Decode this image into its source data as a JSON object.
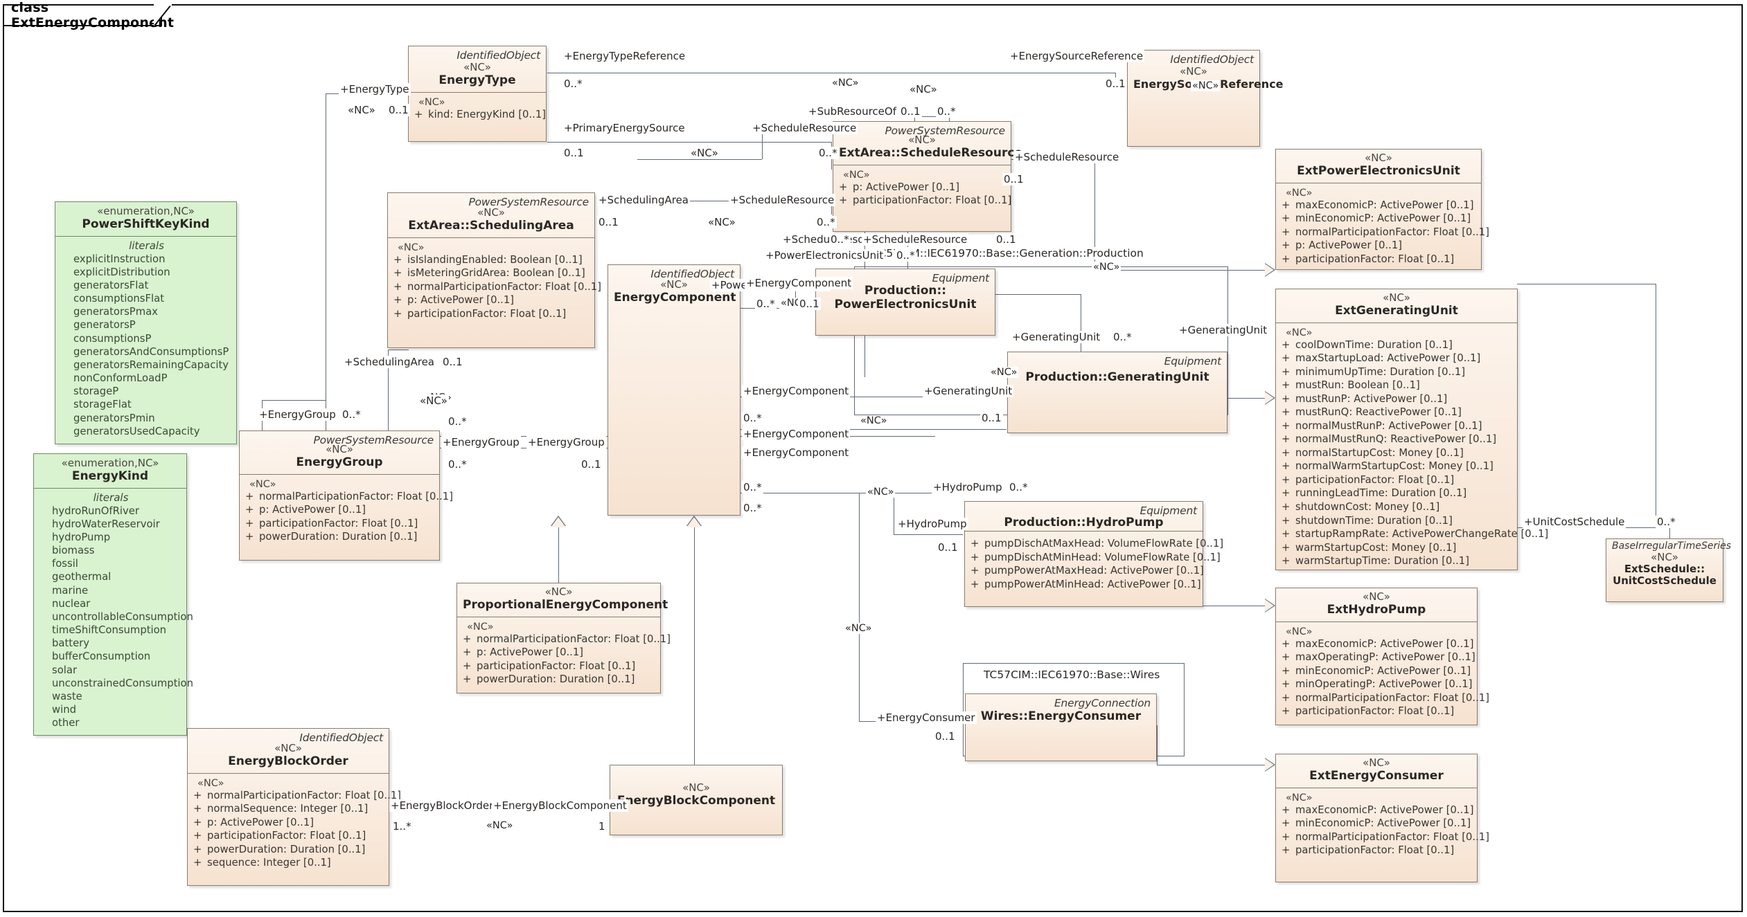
{
  "diagram": {
    "frame_label": "class ExtEnergyComponent"
  },
  "stereotype_nc": "«NC»",
  "literals_label": "literals",
  "enumerations": [
    {
      "id": "powershiftkeykind",
      "stereotype": "«enumeration,NC»",
      "name": "PowerShiftKeyKind",
      "literals": [
        "explicitInstruction",
        "explicitDistribution",
        "generatorsFlat",
        "consumptionsFlat",
        "generatorsPmax",
        "generatorsP",
        "consumptionsP",
        "generatorsAndConsumptionsP",
        "generatorsRemainingCapacity",
        "nonConformLoadP",
        "storageP",
        "storageFlat",
        "generatorsPmin",
        "generatorsUsedCapacity"
      ]
    },
    {
      "id": "energykind",
      "stereotype": "«enumeration,NC»",
      "name": "EnergyKind",
      "literals": [
        "hydroRunOfRiver",
        "hydroWaterReservoir",
        "hydroPump",
        "biomass",
        "fossil",
        "geothermal",
        "marine",
        "nuclear",
        "uncontrollableConsumption",
        "timeShiftConsumption",
        "battery",
        "bufferConsumption",
        "solar",
        "unconstrainedConsumption",
        "waste",
        "wind",
        "other"
      ]
    }
  ],
  "classes": [
    {
      "id": "energytype",
      "parent": "IdentifiedObject",
      "stereotype": "«NC»",
      "name": "EnergyType",
      "attrs": [
        "kind: EnergyKind [0..1]"
      ]
    },
    {
      "id": "energysourcereference",
      "parent": "IdentifiedObject",
      "stereotype": "«NC»",
      "name": "EnergySourceReference",
      "attrs": []
    },
    {
      "id": "schedulingarea",
      "parent": "PowerSystemResource",
      "stereotype": "«NC»",
      "name": "ExtArea::SchedulingArea",
      "attrs": [
        "isIslandingEnabled: Boolean [0..1]",
        "isMeteringGridArea: Boolean [0..1]",
        "normalParticipationFactor: Float [0..1]",
        "p: ActivePower [0..1]",
        "participationFactor: Float [0..1]"
      ]
    },
    {
      "id": "scheduleresource",
      "parent": "PowerSystemResource",
      "stereotype": "«NC»",
      "name": "ExtArea::ScheduleResource",
      "attrs": [
        "p: ActivePower [0..1]",
        "participationFactor: Float [0..1]"
      ]
    },
    {
      "id": "energycomponent",
      "parent": "IdentifiedObject",
      "stereotype": "«NC»",
      "name": "EnergyComponent",
      "attrs": []
    },
    {
      "id": "energygroup",
      "parent": "PowerSystemResource",
      "stereotype": "«NC»",
      "name": "EnergyGroup",
      "attrs": [
        "normalParticipationFactor: Float [0..1]",
        "p: ActivePower [0..1]",
        "participationFactor: Float [0..1]",
        "powerDuration: Duration [0..1]"
      ]
    },
    {
      "id": "proportionalenergycomponent",
      "parent": "",
      "stereotype": "«NC»",
      "name": "ProportionalEnergyComponent",
      "attrs": [
        "normalParticipationFactor: Float [0..1]",
        "p: ActivePower [0..1]",
        "participationFactor: Float [0..1]",
        "powerDuration: Duration [0..1]"
      ]
    },
    {
      "id": "energyblockorder",
      "parent": "IdentifiedObject",
      "stereotype": "«NC»",
      "name": "EnergyBlockOrder",
      "attrs": [
        "normalParticipationFactor: Float [0..1]",
        "normalSequence: Integer [0..1]",
        "p: ActivePower [0..1]",
        "participationFactor: Float [0..1]",
        "powerDuration: Duration [0..1]",
        "sequence: Integer [0..1]"
      ]
    },
    {
      "id": "energyblockcomponent",
      "parent": "",
      "stereotype": "«NC»",
      "name": "EnergyBlockComponent",
      "attrs": []
    },
    {
      "id": "prodpowerelectronicsunit",
      "parent": "Equipment",
      "stereotype": "",
      "name": "Production::\nPowerElectronicsUnit",
      "name_line1": "Production::",
      "name_line2": "PowerElectronicsUnit",
      "attrs": []
    },
    {
      "id": "prodgeneratingunit",
      "parent": "Equipment",
      "stereotype": "",
      "name": "Production::GeneratingUnit",
      "attrs": []
    },
    {
      "id": "prodhydropump",
      "parent": "Equipment",
      "stereotype": "",
      "name": "Production::HydroPump",
      "attrs": [
        "pumpDischAtMaxHead: VolumeFlowRate [0..1]",
        "pumpDischAtMinHead: VolumeFlowRate [0..1]",
        "pumpPowerAtMaxHead: ActivePower [0..1]",
        "pumpPowerAtMinHead: ActivePower [0..1]"
      ]
    },
    {
      "id": "wiresenergyconsumer",
      "parent": "EnergyConnection",
      "stereotype": "",
      "name": "Wires::EnergyConsumer",
      "attrs": []
    },
    {
      "id": "extpowerelectronicsunit",
      "parent": "",
      "stereotype": "«NC»",
      "name": "ExtPowerElectronicsUnit",
      "attrs": [
        "maxEconomicP: ActivePower [0..1]",
        "minEconomicP: ActivePower [0..1]",
        "normalParticipationFactor: Float [0..1]",
        "p: ActivePower [0..1]",
        "participationFactor: Float [0..1]"
      ]
    },
    {
      "id": "extgeneratingunit",
      "parent": "",
      "stereotype": "«NC»",
      "name": "ExtGeneratingUnit",
      "attrs": [
        "coolDownTime: Duration [0..1]",
        "maxStartupLoad: ActivePower [0..1]",
        "minimumUpTime: Duration [0..1]",
        "mustRun: Boolean [0..1]",
        "mustRunP: ActivePower [0..1]",
        "mustRunQ: ReactivePower [0..1]",
        "normalMustRunP: ActivePower [0..1]",
        "normalMustRunQ: ReactivePower [0..1]",
        "normalStartupCost: Money [0..1]",
        "normalWarmStartupCost: Money [0..1]",
        "participationFactor: Float [0..1]",
        "runningLeadTime: Duration [0..1]",
        "shutdownCost: Money [0..1]",
        "shutdownTime: Duration [0..1]",
        "startupRampRate: ActivePowerChangeRate [0..1]",
        "warmStartupCost: Money [0..1]",
        "warmStartupTime: Duration [0..1]"
      ]
    },
    {
      "id": "exthydropump",
      "parent": "",
      "stereotype": "«NC»",
      "name": "ExtHydroPump",
      "attrs": [
        "maxEconomicP: ActivePower [0..1]",
        "maxOperatingP: ActivePower [0..1]",
        "minEconomicP: ActivePower [0..1]",
        "minOperatingP: ActivePower [0..1]",
        "normalParticipationFactor: Float [0..1]",
        "participationFactor: Float [0..1]"
      ]
    },
    {
      "id": "extenergyconsumer",
      "parent": "",
      "stereotype": "«NC»",
      "name": "ExtEnergyConsumer",
      "attrs": [
        "maxEconomicP: ActivePower [0..1]",
        "minEconomicP: ActivePower [0..1]",
        "normalParticipationFactor: Float [0..1]",
        "participationFactor: Float [0..1]"
      ]
    },
    {
      "id": "extunitcostschedule",
      "parent": "BaseIrregularTimeSeries",
      "stereotype": "«NC»",
      "name": "ExtSchedule::\nUnitCostSchedule",
      "name_line1": "ExtSchedule::",
      "name_line2": "UnitCostSchedule",
      "attrs": []
    }
  ],
  "packages": [
    {
      "id": "pkg-production",
      "label": "TC57CIM::IEC61970::Base::Generation::Production"
    },
    {
      "id": "pkg-wires",
      "label": "TC57CIM::IEC61970::Base::Wires"
    }
  ],
  "edge_labels": [
    {
      "id": "l1",
      "text": "+EnergyType"
    },
    {
      "id": "l2",
      "text": "«NC»"
    },
    {
      "id": "l3",
      "text": "0..1"
    },
    {
      "id": "l4",
      "text": "+EnergyTypeReference"
    },
    {
      "id": "l5",
      "text": "0..*"
    },
    {
      "id": "l6",
      "text": "+EnergySourceReference"
    },
    {
      "id": "l7",
      "text": "0..1"
    },
    {
      "id": "l8",
      "text": "«NC»"
    },
    {
      "id": "l9",
      "text": "«NC»"
    },
    {
      "id": "l10",
      "text": "+PrimaryEnergySource"
    },
    {
      "id": "l11",
      "text": "0..1"
    },
    {
      "id": "l12",
      "text": "+SubResourceOf"
    },
    {
      "id": "l13",
      "text": "0..1"
    },
    {
      "id": "l14",
      "text": "0..*"
    },
    {
      "id": "l15",
      "text": "+ScheduleResource"
    },
    {
      "id": "l16",
      "text": "«NC»"
    },
    {
      "id": "l17",
      "text": "0..*"
    },
    {
      "id": "l18",
      "text": "+SchedulingArea"
    },
    {
      "id": "l19",
      "text": "0..1"
    },
    {
      "id": "l20",
      "text": "+ScheduleResource"
    },
    {
      "id": "l21",
      "text": "«NC»"
    },
    {
      "id": "l22",
      "text": "0..*"
    },
    {
      "id": "l23",
      "text": "+ScheduleResource"
    },
    {
      "id": "l24",
      "text": "0..*"
    },
    {
      "id": "l25",
      "text": "+ScheduleResource"
    },
    {
      "id": "l26",
      "text": "0..1"
    },
    {
      "id": "l27",
      "text": "+ScheduleResource"
    },
    {
      "id": "l28",
      "text": "0..1"
    },
    {
      "id": "l29",
      "text": "+PowerElectronicsUnit"
    },
    {
      "id": "l30",
      "text": "0..*"
    },
    {
      "id": "l31",
      "text": "+PowerElectronicsUnit"
    },
    {
      "id": "l32",
      "text": "0..*"
    },
    {
      "id": "l33",
      "text": "«NC»"
    },
    {
      "id": "l34",
      "text": "0..1"
    },
    {
      "id": "l35",
      "text": "+EnergyComponent"
    },
    {
      "id": "l36",
      "text": "«NC»"
    },
    {
      "id": "l37",
      "text": "0..*"
    },
    {
      "id": "l38",
      "text": "+SchedulingArea"
    },
    {
      "id": "l39",
      "text": "0..1"
    },
    {
      "id": "l40",
      "text": "+EnergyGroup"
    },
    {
      "id": "l41",
      "text": "0..*"
    },
    {
      "id": "l42",
      "text": "«NC»"
    },
    {
      "id": "l43",
      "text": "+EnergyGroup"
    },
    {
      "id": "l44",
      "text": "0..*"
    },
    {
      "id": "l45",
      "text": "+EnergyGroup"
    },
    {
      "id": "l46",
      "text": "0..1"
    },
    {
      "id": "l47",
      "text": "+EnergyComponent"
    },
    {
      "id": "l48",
      "text": "0..*"
    },
    {
      "id": "l49",
      "text": "+EnergyComponent"
    },
    {
      "id": "l50",
      "text": "«NC»"
    },
    {
      "id": "l51",
      "text": "0..*"
    },
    {
      "id": "l52",
      "text": "+GeneratingUnit"
    },
    {
      "id": "l53",
      "text": "0..1"
    },
    {
      "id": "l54",
      "text": "+GeneratingUnit"
    },
    {
      "id": "l55",
      "text": "0..*"
    },
    {
      "id": "l56",
      "text": "+GeneratingUnit"
    },
    {
      "id": "l57",
      "text": "«NC»"
    },
    {
      "id": "l58",
      "text": "+EnergyComponent"
    },
    {
      "id": "l59",
      "text": "«NC»"
    },
    {
      "id": "l60",
      "text": "0..*"
    },
    {
      "id": "l61",
      "text": "+HydroPump"
    },
    {
      "id": "l62",
      "text": "0..*"
    },
    {
      "id": "l63",
      "text": "+HydroPump"
    },
    {
      "id": "l64",
      "text": "0..1"
    },
    {
      "id": "l65",
      "text": "«NC»"
    },
    {
      "id": "l66",
      "text": "+EnergyConsumer"
    },
    {
      "id": "l67",
      "text": "0..1"
    },
    {
      "id": "l68",
      "text": "+EnergyBlockOrder"
    },
    {
      "id": "l69",
      "text": "+EnergyBlockComponent"
    },
    {
      "id": "l70",
      "text": "1..*"
    },
    {
      "id": "l71",
      "text": "«NC»"
    },
    {
      "id": "l72",
      "text": "1"
    },
    {
      "id": "l73",
      "text": "+UnitCostSchedule"
    },
    {
      "id": "l74",
      "text": "0..*"
    },
    {
      "id": "l75",
      "text": "«NC»"
    },
    {
      "id": "l76",
      "text": "«NC»"
    },
    {
      "id": "l77",
      "text": "«NC»"
    }
  ],
  "colors": {
    "class_fill": "#fbf0e6",
    "class_border": "#8a7b6f",
    "enum_fill": "#d9f2cf",
    "enum_border": "#6f8a6a",
    "line": "#5d6a78",
    "text": "#2b2724"
  }
}
